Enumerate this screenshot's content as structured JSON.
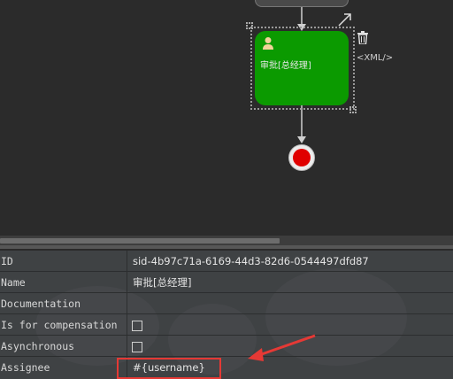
{
  "canvas": {
    "task": {
      "label": "审批[总经理]",
      "color": "#0b9a00"
    },
    "xml_link": "<XML/>",
    "end_event_color": "#e00000",
    "icons": [
      "user-icon",
      "connect-arrow-icon",
      "trash-icon"
    ]
  },
  "properties": {
    "rows": [
      {
        "label": "ID",
        "value": "sid-4b97c71a-6169-44d3-82d6-0544497dfd87"
      },
      {
        "label": "Name",
        "value": "审批[总经理]"
      },
      {
        "label": "Documentation",
        "value": ""
      },
      {
        "label": "Is for compensation",
        "checked": false
      },
      {
        "label": "Asynchronous",
        "checked": false
      },
      {
        "label": "Assignee",
        "value": "#{username}"
      }
    ]
  },
  "annotation": {
    "highlight_color": "#e53935"
  }
}
